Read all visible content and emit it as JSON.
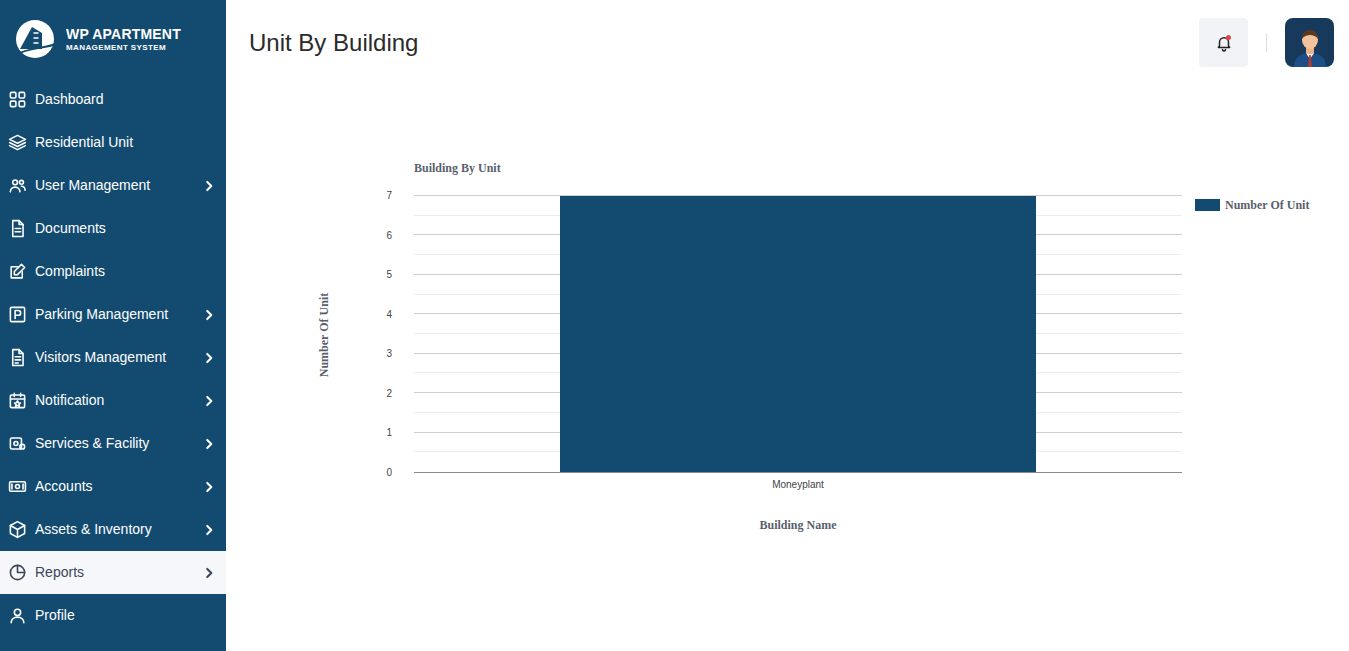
{
  "logo": {
    "line1": "WP APARTMENT",
    "line2": "MANAGEMENT SYSTEM"
  },
  "sidebar": {
    "items": [
      {
        "label": "Dashboard",
        "expandable": false,
        "selected": false
      },
      {
        "label": "Residential Unit",
        "expandable": false,
        "selected": false
      },
      {
        "label": "User Management",
        "expandable": true,
        "selected": false
      },
      {
        "label": "Documents",
        "expandable": false,
        "selected": false
      },
      {
        "label": "Complaints",
        "expandable": false,
        "selected": false
      },
      {
        "label": "Parking Management",
        "expandable": true,
        "selected": false
      },
      {
        "label": "Visitors Management",
        "expandable": true,
        "selected": false
      },
      {
        "label": "Notification",
        "expandable": true,
        "selected": false
      },
      {
        "label": "Services & Facility",
        "expandable": true,
        "selected": false
      },
      {
        "label": "Accounts",
        "expandable": true,
        "selected": false
      },
      {
        "label": "Assets & Inventory",
        "expandable": true,
        "selected": false
      },
      {
        "label": "Reports",
        "expandable": true,
        "selected": true
      },
      {
        "label": "Profile",
        "expandable": false,
        "selected": false
      }
    ]
  },
  "page": {
    "title": "Unit By Building",
    "notification_unread": true
  },
  "chart": {
    "title": "Building By Unit",
    "y_axis_label": "Number Of Unit",
    "x_axis_label": "Building Name",
    "ticks": [
      "0",
      "1",
      "2",
      "3",
      "4",
      "5",
      "6",
      "7"
    ],
    "categories": [
      "Moneyplant"
    ],
    "series": [
      {
        "name": "Number Of Unit",
        "values": [
          7
        ]
      }
    ]
  }
}
